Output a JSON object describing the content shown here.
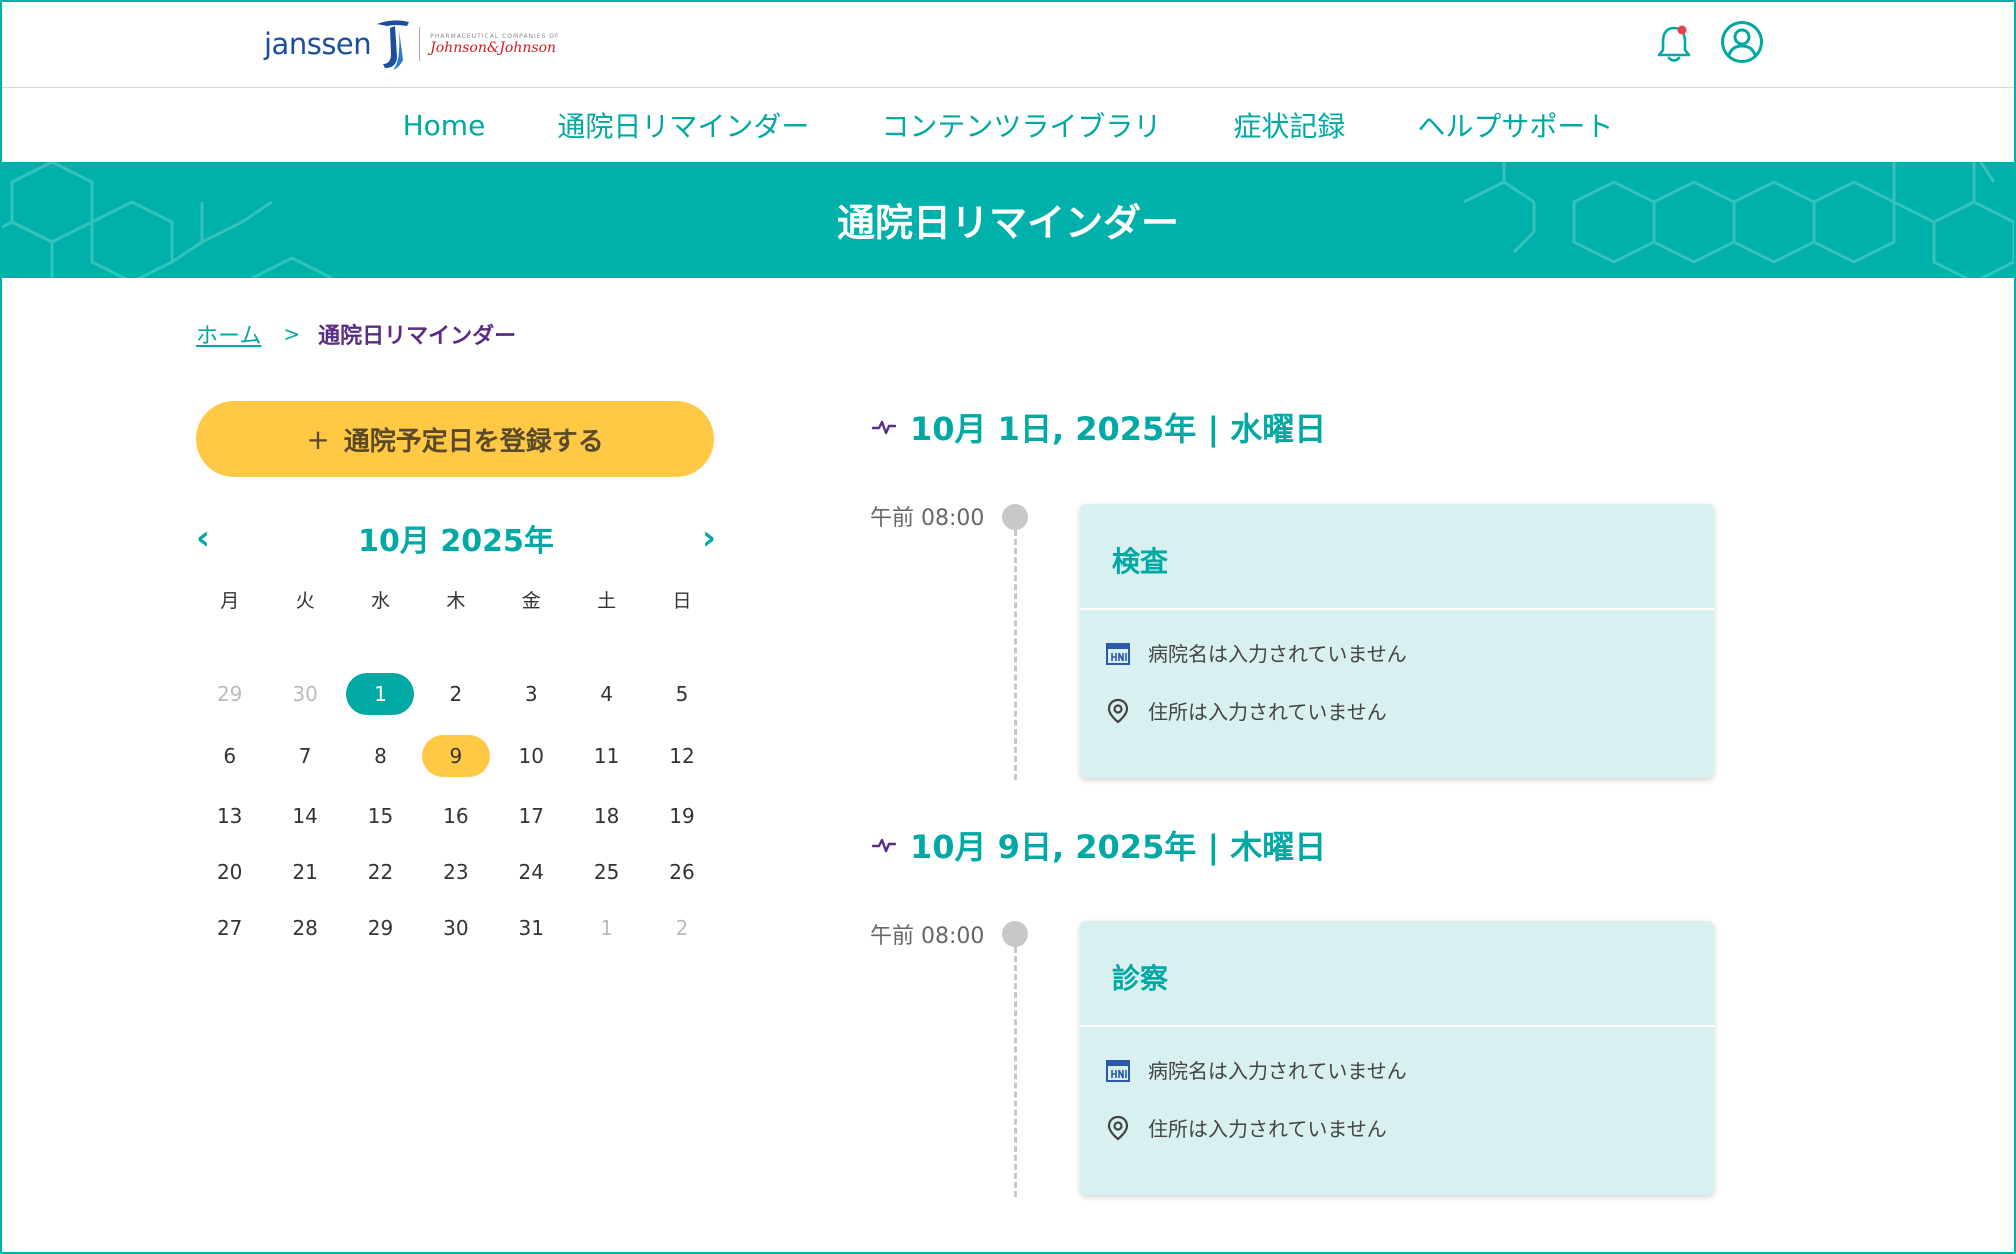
{
  "header": {
    "logo_brand": "janssen",
    "logo_sub": "PHARMACEUTICAL COMPANIES OF",
    "logo_parent": "Johnson&Johnson",
    "bell_icon": "bell-icon",
    "user_icon": "user-icon",
    "accent_color": "#00b1ab",
    "notification_dot_color": "#e8434b"
  },
  "nav": {
    "items": [
      {
        "label": "Home"
      },
      {
        "label": "通院日リマインダー"
      },
      {
        "label": "コンテンツライブラリ"
      },
      {
        "label": "症状記録"
      },
      {
        "label": "ヘルプサポート"
      }
    ]
  },
  "banner": {
    "title": "通院日リマインダー"
  },
  "breadcrumb": {
    "home": "ホーム",
    "separator": ">",
    "current": "通院日リマインダー"
  },
  "register_button": {
    "plus": "+",
    "label": "通院予定日を登録する",
    "color": "#ffc845"
  },
  "calendar": {
    "title": "10月 2025年",
    "prev": "‹",
    "next": "›",
    "weekdays": [
      "月",
      "火",
      "水",
      "木",
      "金",
      "土",
      "日"
    ],
    "weeks": [
      [
        {
          "d": "29",
          "muted": true
        },
        {
          "d": "30",
          "muted": true
        },
        {
          "d": "1",
          "selected": true
        },
        {
          "d": "2"
        },
        {
          "d": "3"
        },
        {
          "d": "4"
        },
        {
          "d": "5"
        }
      ],
      [
        {
          "d": "6"
        },
        {
          "d": "7"
        },
        {
          "d": "8"
        },
        {
          "d": "9",
          "today": true
        },
        {
          "d": "10"
        },
        {
          "d": "11"
        },
        {
          "d": "12"
        }
      ],
      [
        {
          "d": "13"
        },
        {
          "d": "14"
        },
        {
          "d": "15"
        },
        {
          "d": "16"
        },
        {
          "d": "17"
        },
        {
          "d": "18"
        },
        {
          "d": "19"
        }
      ],
      [
        {
          "d": "20"
        },
        {
          "d": "21"
        },
        {
          "d": "22"
        },
        {
          "d": "23"
        },
        {
          "d": "24"
        },
        {
          "d": "25"
        },
        {
          "d": "26"
        }
      ],
      [
        {
          "d": "27"
        },
        {
          "d": "28"
        },
        {
          "d": "29"
        },
        {
          "d": "30"
        },
        {
          "d": "31"
        },
        {
          "d": "1",
          "muted": true
        },
        {
          "d": "2",
          "muted": true
        }
      ]
    ]
  },
  "schedule": [
    {
      "date_heading": "10月 1日, 2025年 | 水曜日",
      "time": "午前 08:00",
      "title": "検査",
      "hospital": "病院名は入力されていません",
      "address": "住所は入力されていません"
    },
    {
      "date_heading": "10月 9日, 2025年 | 木曜日",
      "time": "午前 08:00",
      "title": "診察",
      "hospital": "病院名は入力されていません",
      "address": "住所は入力されていません"
    }
  ]
}
